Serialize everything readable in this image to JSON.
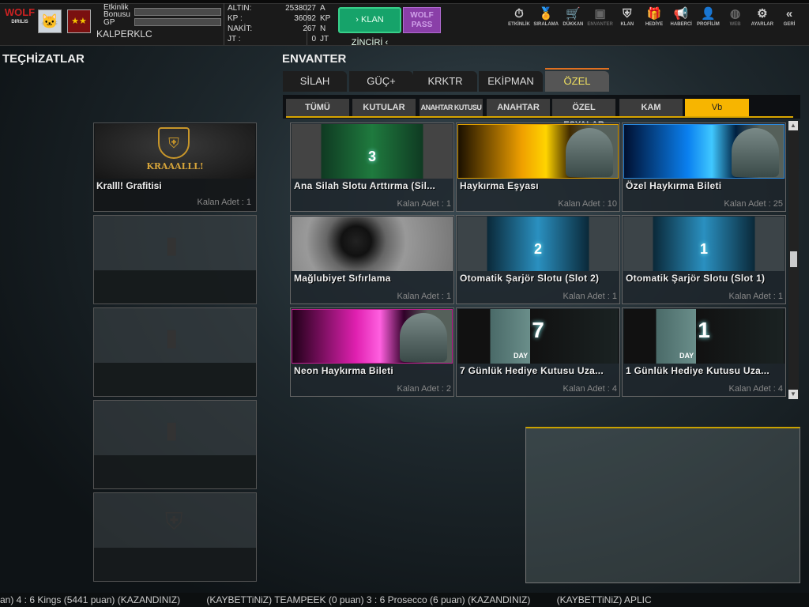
{
  "header": {
    "logo": "WOLF",
    "logo_sub": "DIRILIS",
    "etkinlik_label": "Etkinlik Bonusu",
    "gp_label": "GP",
    "username": "KALPERKLC",
    "stats": [
      {
        "label": "ALTIN:",
        "value": "2538027",
        "unit": "A"
      },
      {
        "label": "KP  :",
        "value": "36092",
        "unit": "KP"
      },
      {
        "label": "NAKİT:",
        "value": "267",
        "unit": "N"
      },
      {
        "label": "JT  :",
        "value": "0",
        "unit": "JT"
      }
    ],
    "klan_button": "› KLAN ZİNCİRİ ‹",
    "wolf_pass_button": "WOLF PASS"
  },
  "nav": [
    {
      "label": "ETKİNLİK",
      "icon": "stopwatch-icon",
      "g": "⏱"
    },
    {
      "label": "SIRALAMA",
      "icon": "medal-icon",
      "g": "🏅"
    },
    {
      "label": "DÜKKAN",
      "icon": "cart-icon",
      "g": "🛒"
    },
    {
      "label": "ENVANTER",
      "icon": "chest-icon",
      "g": "▣"
    },
    {
      "label": "KLAN",
      "icon": "shield-icon",
      "g": "⛨"
    },
    {
      "label": "HEDİYE",
      "icon": "gift-icon",
      "g": "🎁"
    },
    {
      "label": "HABERCİ",
      "icon": "megaphone-icon",
      "g": "📢"
    },
    {
      "label": "PROFİLİM",
      "icon": "profile-icon",
      "g": "👤"
    },
    {
      "label": "WEB",
      "icon": "globe-icon",
      "g": "◍"
    },
    {
      "label": "AYARLAR",
      "icon": "gear-icon",
      "g": "⚙"
    },
    {
      "label": "GERİ",
      "icon": "back-icon",
      "g": "«"
    }
  ],
  "left": {
    "title": "TEÇHİZATLAR",
    "slot": {
      "name": "Kralll! Grafitisi",
      "count": "Kalan Adet : 1",
      "logo_text": "KRAAALLL!"
    }
  },
  "inventory": {
    "title": "ENVANTER",
    "tabs": [
      "SİLAH",
      "GÜÇ+",
      "KRKTR",
      "EKİPMAN",
      "ÖZEL"
    ],
    "subtabs": [
      "TÜMÜ",
      "KUTULAR",
      "ANAHTAR KUTUSU",
      "ANAHTAR",
      "ÖZEL EŞYALAR",
      "KAM",
      "Vb"
    ],
    "items": [
      {
        "name": "Ana Silah Slotu Arttırma (Sil...",
        "count": "Kalan Adet : 1",
        "badge": "3"
      },
      {
        "name": "Haykırma Eşyası",
        "count": "Kalan Adet : 10",
        "badge": ""
      },
      {
        "name": "Özel Haykırma Bileti",
        "count": "Kalan Adet : 25",
        "badge": ""
      },
      {
        "name": "Mağlubiyet  Sıfırlama",
        "count": "Kalan Adet : 1",
        "badge": ""
      },
      {
        "name": "Otomatik Şarjör Slotu (Slot 2)",
        "count": "Kalan Adet : 1",
        "badge": "2"
      },
      {
        "name": "Otomatik Şarjör Slotu (Slot 1)",
        "count": "Kalan Adet : 1",
        "badge": "1"
      },
      {
        "name": "Neon Haykırma Bileti",
        "count": "Kalan Adet : 2",
        "badge": ""
      },
      {
        "name": "7 Günlük Hediye Kutusu Uza...",
        "count": "Kalan Adet : 4",
        "badge": "7"
      },
      {
        "name": "1 Günlük Hediye Kutusu Uza...",
        "count": "Kalan Adet : 4",
        "badge": "1"
      }
    ],
    "day_label": "DAY"
  },
  "ticker": "an) 4 : 6 Kings (5441 puan) (KAZANDINIZ)          (KAYBETTiNiZ) TEAMPEEK (0 puan) 3 : 6 Prosecco (6 puan) (KAZANDINIZ)          (KAYBETTiNiZ) APLIC"
}
